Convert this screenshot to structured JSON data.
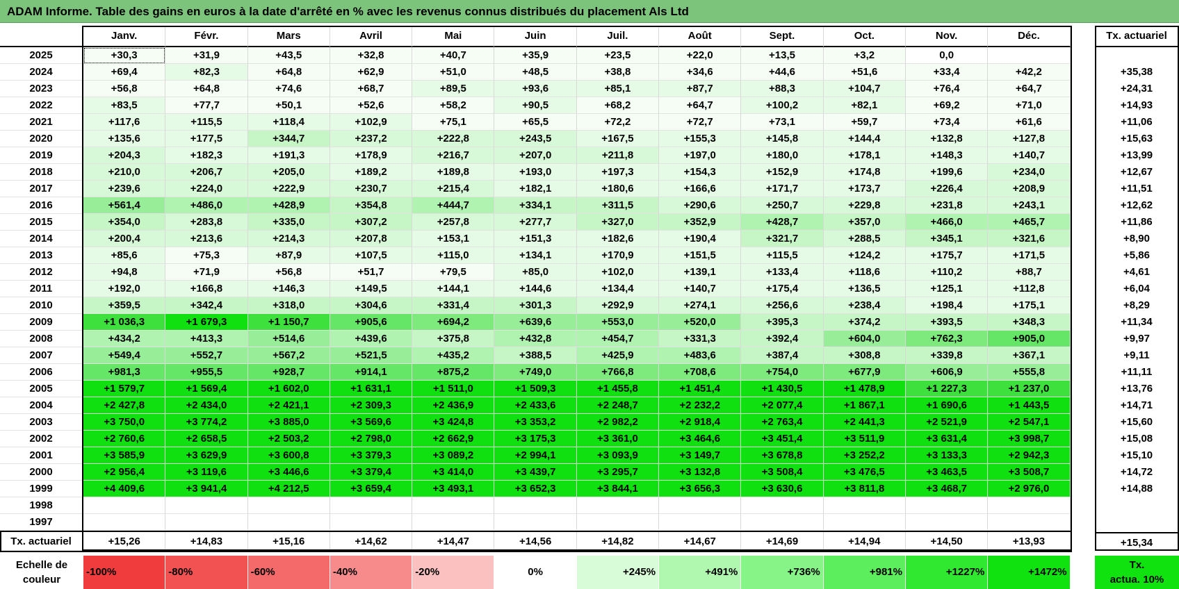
{
  "title": "ADAM Informe. Table des gains en euros à la date d'arrêté en % avec les revenus connus distribués du placement Als Ltd",
  "months": [
    "Janv.",
    "Févr.",
    "Mars",
    "Avril",
    "Mai",
    "Juin",
    "Juil.",
    "Août",
    "Sept.",
    "Oct.",
    "Nov.",
    "Déc."
  ],
  "side_header": "Tx. actuariel",
  "colors": {
    "title_bg": "#7cc47c",
    "neg_strong": "#f03c3c",
    "pos_strong": "#00e000"
  },
  "rows": [
    {
      "year": "2025",
      "values": [
        "+30,3",
        "+31,9",
        "+43,5",
        "+32,8",
        "+40,7",
        "+35,9",
        "+23,5",
        "+22,0",
        "+13,5",
        "+3,2",
        "0,0",
        ""
      ],
      "rate": ""
    },
    {
      "year": "2024",
      "values": [
        "+69,4",
        "+82,3",
        "+64,8",
        "+62,9",
        "+51,0",
        "+48,5",
        "+38,8",
        "+34,6",
        "+44,6",
        "+51,6",
        "+33,4",
        "+42,2"
      ],
      "rate": "+35,38"
    },
    {
      "year": "2023",
      "values": [
        "+56,8",
        "+64,8",
        "+74,6",
        "+68,7",
        "+89,5",
        "+93,6",
        "+85,1",
        "+87,7",
        "+88,3",
        "+104,7",
        "+76,4",
        "+64,7"
      ],
      "rate": "+24,31"
    },
    {
      "year": "2022",
      "values": [
        "+83,5",
        "+77,7",
        "+50,1",
        "+52,6",
        "+58,2",
        "+90,5",
        "+68,2",
        "+64,7",
        "+100,2",
        "+82,1",
        "+69,2",
        "+71,0"
      ],
      "rate": "+14,93"
    },
    {
      "year": "2021",
      "values": [
        "+117,6",
        "+115,5",
        "+118,4",
        "+102,9",
        "+75,1",
        "+65,5",
        "+72,2",
        "+72,7",
        "+73,1",
        "+59,7",
        "+73,4",
        "+61,6"
      ],
      "rate": "+11,06"
    },
    {
      "year": "2020",
      "values": [
        "+135,6",
        "+177,5",
        "+344,7",
        "+237,2",
        "+222,8",
        "+243,5",
        "+167,5",
        "+155,3",
        "+145,8",
        "+144,4",
        "+132,8",
        "+127,8"
      ],
      "rate": "+15,63"
    },
    {
      "year": "2019",
      "values": [
        "+204,3",
        "+182,3",
        "+191,3",
        "+178,9",
        "+216,7",
        "+207,0",
        "+211,8",
        "+197,0",
        "+180,0",
        "+178,1",
        "+148,3",
        "+140,7"
      ],
      "rate": "+13,99"
    },
    {
      "year": "2018",
      "values": [
        "+210,0",
        "+206,7",
        "+205,0",
        "+189,2",
        "+189,8",
        "+193,0",
        "+197,3",
        "+154,3",
        "+152,9",
        "+174,8",
        "+199,6",
        "+234,0"
      ],
      "rate": "+12,67"
    },
    {
      "year": "2017",
      "values": [
        "+239,6",
        "+224,0",
        "+222,9",
        "+230,7",
        "+215,4",
        "+182,1",
        "+180,6",
        "+166,6",
        "+171,7",
        "+173,7",
        "+226,4",
        "+208,9"
      ],
      "rate": "+11,51"
    },
    {
      "year": "2016",
      "values": [
        "+561,4",
        "+486,0",
        "+428,9",
        "+354,8",
        "+444,7",
        "+334,1",
        "+311,5",
        "+290,6",
        "+250,7",
        "+229,8",
        "+231,8",
        "+243,1"
      ],
      "rate": "+12,62"
    },
    {
      "year": "2015",
      "values": [
        "+354,0",
        "+283,8",
        "+335,0",
        "+307,2",
        "+257,8",
        "+277,7",
        "+327,0",
        "+352,9",
        "+428,7",
        "+357,0",
        "+466,0",
        "+465,7"
      ],
      "rate": "+11,86"
    },
    {
      "year": "2014",
      "values": [
        "+200,4",
        "+213,6",
        "+214,3",
        "+207,8",
        "+153,1",
        "+151,3",
        "+182,6",
        "+190,4",
        "+321,7",
        "+288,5",
        "+345,1",
        "+321,6"
      ],
      "rate": "+8,90"
    },
    {
      "year": "2013",
      "values": [
        "+85,6",
        "+75,3",
        "+87,9",
        "+107,5",
        "+115,0",
        "+134,1",
        "+170,9",
        "+151,5",
        "+115,5",
        "+124,2",
        "+175,7",
        "+171,5"
      ],
      "rate": "+5,86"
    },
    {
      "year": "2012",
      "values": [
        "+94,8",
        "+71,9",
        "+56,8",
        "+51,7",
        "+79,5",
        "+85,0",
        "+102,0",
        "+139,1",
        "+133,4",
        "+118,6",
        "+110,2",
        "+88,7"
      ],
      "rate": "+4,61"
    },
    {
      "year": "2011",
      "values": [
        "+192,0",
        "+166,8",
        "+146,3",
        "+149,5",
        "+144,1",
        "+144,6",
        "+134,4",
        "+140,7",
        "+175,4",
        "+136,5",
        "+125,1",
        "+112,8"
      ],
      "rate": "+6,04"
    },
    {
      "year": "2010",
      "values": [
        "+359,5",
        "+342,4",
        "+318,0",
        "+304,6",
        "+331,4",
        "+301,3",
        "+292,9",
        "+274,1",
        "+256,6",
        "+238,4",
        "+198,4",
        "+175,1"
      ],
      "rate": "+8,29"
    },
    {
      "year": "2009",
      "values": [
        "+1 036,3",
        "+1 679,3",
        "+1 150,7",
        "+905,6",
        "+694,2",
        "+639,6",
        "+553,0",
        "+520,0",
        "+395,3",
        "+374,2",
        "+393,5",
        "+348,3"
      ],
      "rate": "+11,34"
    },
    {
      "year": "2008",
      "values": [
        "+434,2",
        "+413,3",
        "+514,6",
        "+439,6",
        "+375,8",
        "+432,8",
        "+454,7",
        "+331,3",
        "+392,4",
        "+604,0",
        "+762,3",
        "+905,0"
      ],
      "rate": "+9,97"
    },
    {
      "year": "2007",
      "values": [
        "+549,4",
        "+552,7",
        "+567,2",
        "+521,5",
        "+435,2",
        "+388,5",
        "+425,9",
        "+483,6",
        "+387,4",
        "+308,8",
        "+339,8",
        "+367,1"
      ],
      "rate": "+9,11"
    },
    {
      "year": "2006",
      "values": [
        "+981,3",
        "+955,5",
        "+928,7",
        "+914,1",
        "+875,2",
        "+749,0",
        "+766,8",
        "+708,6",
        "+754,0",
        "+677,9",
        "+606,9",
        "+555,8"
      ],
      "rate": "+11,11"
    },
    {
      "year": "2005",
      "values": [
        "+1 579,7",
        "+1 569,4",
        "+1 602,0",
        "+1 631,1",
        "+1 511,0",
        "+1 509,3",
        "+1 455,8",
        "+1 451,4",
        "+1 430,5",
        "+1 478,9",
        "+1 227,3",
        "+1 237,0"
      ],
      "rate": "+13,76"
    },
    {
      "year": "2004",
      "values": [
        "+2 427,8",
        "+2 434,0",
        "+2 421,1",
        "+2 309,3",
        "+2 436,9",
        "+2 433,6",
        "+2 248,7",
        "+2 232,2",
        "+2 077,4",
        "+1 867,1",
        "+1 690,6",
        "+1 443,5"
      ],
      "rate": "+14,71"
    },
    {
      "year": "2003",
      "values": [
        "+3 750,0",
        "+3 774,2",
        "+3 885,0",
        "+3 569,6",
        "+3 424,8",
        "+3 353,2",
        "+2 982,2",
        "+2 918,4",
        "+2 763,4",
        "+2 441,3",
        "+2 521,9",
        "+2 547,1"
      ],
      "rate": "+15,60"
    },
    {
      "year": "2002",
      "values": [
        "+2 760,6",
        "+2 658,5",
        "+2 503,2",
        "+2 798,0",
        "+2 662,9",
        "+3 175,3",
        "+3 361,0",
        "+3 464,6",
        "+3 451,4",
        "+3 511,9",
        "+3 631,4",
        "+3 998,7"
      ],
      "rate": "+15,08"
    },
    {
      "year": "2001",
      "values": [
        "+3 585,9",
        "+3 629,9",
        "+3 600,8",
        "+3 379,3",
        "+3 089,2",
        "+2 994,1",
        "+3 093,9",
        "+3 149,7",
        "+3 678,8",
        "+3 252,2",
        "+3 133,3",
        "+2 942,3"
      ],
      "rate": "+15,10"
    },
    {
      "year": "2000",
      "values": [
        "+2 956,4",
        "+3 119,6",
        "+3 446,6",
        "+3 379,4",
        "+3 414,0",
        "+3 439,7",
        "+3 295,7",
        "+3 132,8",
        "+3 508,4",
        "+3 476,5",
        "+3 463,5",
        "+3 508,7"
      ],
      "rate": "+14,72"
    },
    {
      "year": "1999",
      "values": [
        "+4 409,6",
        "+3 941,4",
        "+4 212,5",
        "+3 659,4",
        "+3 493,1",
        "+3 652,3",
        "+3 844,1",
        "+3 656,3",
        "+3 630,6",
        "+3 811,8",
        "+3 468,7",
        "+2 976,0"
      ],
      "rate": "+14,88"
    },
    {
      "year": "1998",
      "values": [
        "",
        "",
        "",
        "",
        "",
        "",
        "",
        "",
        "",
        "",
        "",
        ""
      ],
      "rate": ""
    },
    {
      "year": "1997",
      "values": [
        "",
        "",
        "",
        "",
        "",
        "",
        "",
        "",
        "",
        "",
        "",
        ""
      ],
      "rate": ""
    }
  ],
  "footer": {
    "label": "Tx. actuariel",
    "values": [
      "+15,26",
      "+14,83",
      "+15,16",
      "+14,62",
      "+14,47",
      "+14,56",
      "+14,82",
      "+14,67",
      "+14,69",
      "+14,94",
      "+14,50",
      "+13,93"
    ],
    "rate": "+15,34"
  },
  "legend": {
    "label_line1": "Echelle de",
    "label_line2": "couleur",
    "steps": [
      {
        "text": "-100%",
        "color": "#f03c3c",
        "align": "left"
      },
      {
        "text": "-80%",
        "color": "#f25252",
        "align": "left"
      },
      {
        "text": "-60%",
        "color": "#f46a6a",
        "align": "left"
      },
      {
        "text": "-40%",
        "color": "#f78a8a",
        "align": "left"
      },
      {
        "text": "-20%",
        "color": "#fbc0c0",
        "align": "left"
      },
      {
        "text": "0%",
        "color": "#ffffff",
        "align": "center"
      },
      {
        "text": "+245%",
        "color": "#d8fcd8",
        "align": "right"
      },
      {
        "text": "+491%",
        "color": "#b0f8b0",
        "align": "right"
      },
      {
        "text": "+736%",
        "color": "#86f486",
        "align": "right"
      },
      {
        "text": "+981%",
        "color": "#5cee5c",
        "align": "right"
      },
      {
        "text": "+1227%",
        "color": "#30e830",
        "align": "right"
      },
      {
        "text": "+1472%",
        "color": "#10e210",
        "align": "right"
      }
    ],
    "side_line1": "Tx.",
    "side_line2": "actua. 10%",
    "side_color": "#10e210"
  }
}
